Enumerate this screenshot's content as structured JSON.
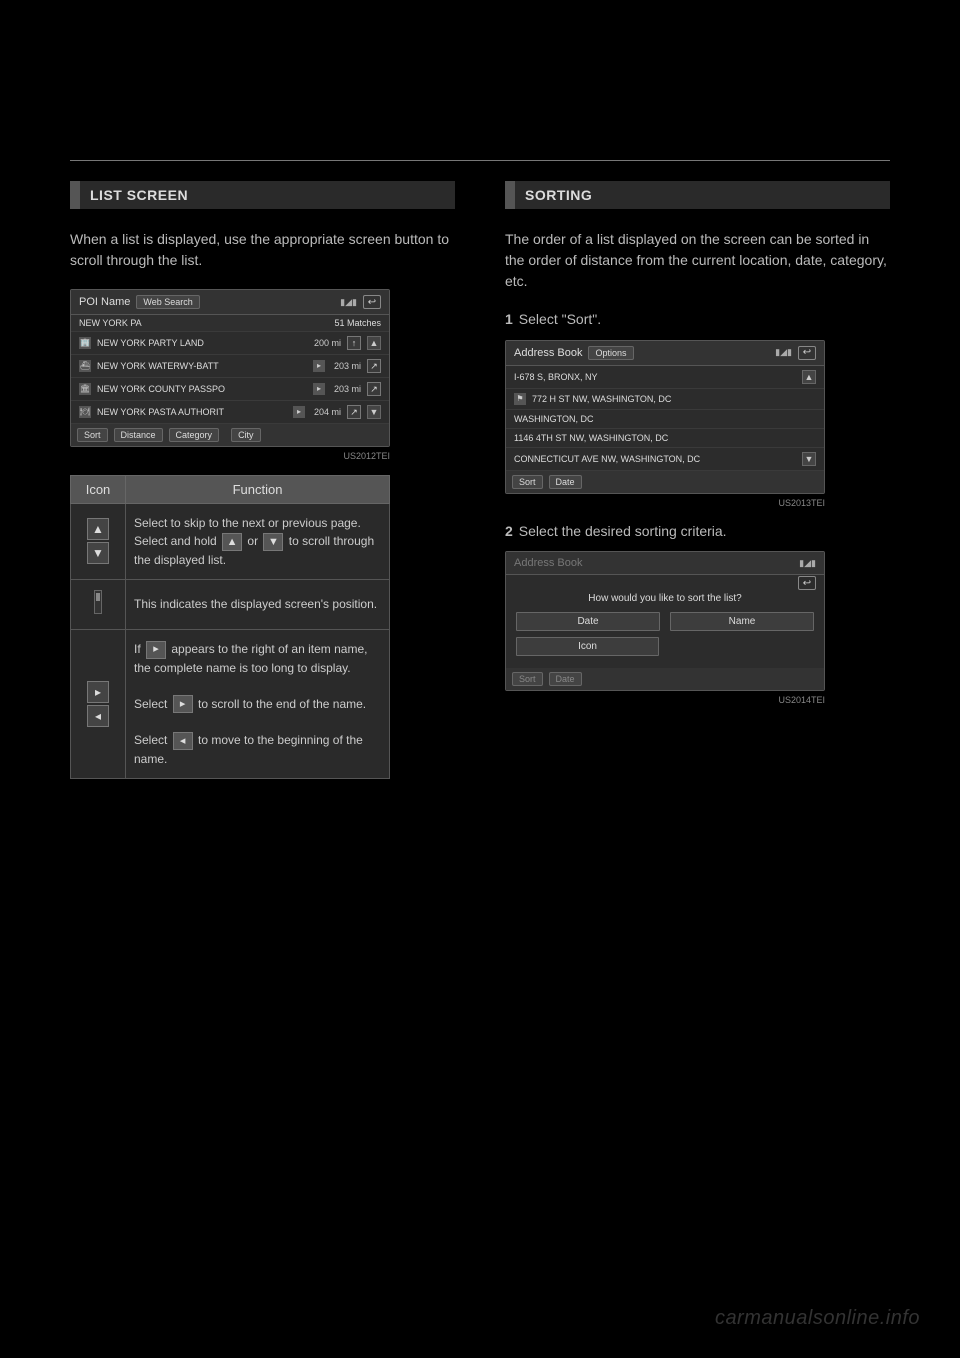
{
  "left": {
    "heading": "LIST SCREEN",
    "intro": "When a list is displayed, use the appropriate screen button to scroll through the list.",
    "shot_id": "US2012TEI",
    "poi": {
      "title": "POI Name",
      "websearch": "Web Search",
      "query": "NEW YORK PA",
      "matches": "51 Matches",
      "rows": [
        {
          "name": "NEW YORK PARTY LAND",
          "dist": "200 mi",
          "dir": "↑"
        },
        {
          "name": "NEW YORK WATERWY-BATT",
          "dist": "203 mi",
          "dir": "↗"
        },
        {
          "name": "NEW YORK COUNTY PASSPO",
          "dist": "203 mi",
          "dir": "↗"
        },
        {
          "name": "NEW YORK PASTA AUTHORIT",
          "dist": "204 mi",
          "dir": "↗"
        }
      ],
      "footer": {
        "sort": "Sort",
        "distance": "Distance",
        "category": "Category",
        "city": "City"
      }
    },
    "table": {
      "h_icon": "Icon",
      "h_func": "Function",
      "r1a": "Select to skip to the next or previous page.",
      "r1b_pre": "Select and hold ",
      "r1b_mid": " or ",
      "r1b_post": " to scroll through the displayed list.",
      "r2": "This indicates the displayed screen's position.",
      "r3a_pre": "If ",
      "r3a_post": " appears to the right of an item name, the complete name is too long to display.",
      "r3b_pre": "Select ",
      "r3b_post": " to scroll to the end of the name.",
      "r3c_pre": "Select ",
      "r3c_post": " to move to the beginning of the name."
    }
  },
  "right": {
    "heading": "SORTING",
    "intro": "The order of a list displayed on the screen can be sorted in the order of distance from the current location, date, category, etc.",
    "step1": "Select \"Sort\".",
    "step2": "Select the desired sorting criteria.",
    "shot1_id": "US2013TEI",
    "shot2_id": "US2014TEI",
    "addr": {
      "title": "Address Book",
      "options": "Options",
      "rows": [
        "I-678 S, BRONX, NY",
        "772 H ST NW, WASHINGTON, DC",
        "WASHINGTON, DC",
        "1146 4TH ST NW, WASHINGTON, DC",
        "CONNECTICUT AVE NW, WASHINGTON, DC"
      ],
      "footer": {
        "sort": "Sort",
        "date": "Date"
      }
    },
    "sortdlg": {
      "title": "Address Book",
      "q": "How would you like to sort the list?",
      "date": "Date",
      "name": "Name",
      "icon": "Icon",
      "footer_sort": "Sort",
      "footer_date": "Date"
    }
  },
  "watermark": "carmanualsonline.info"
}
